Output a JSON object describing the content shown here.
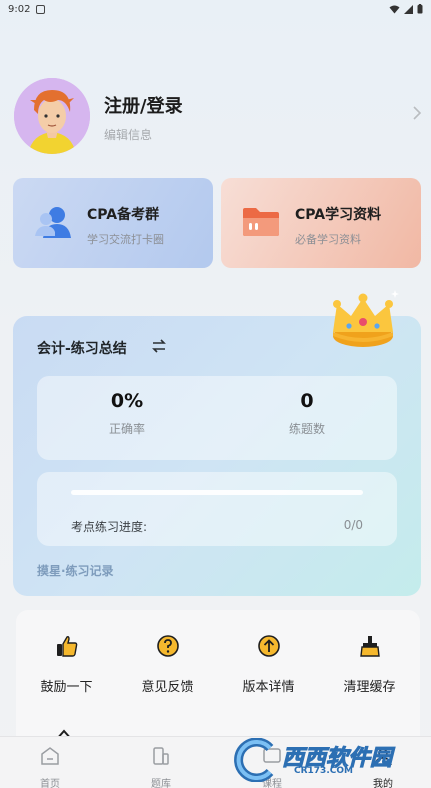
{
  "status": {
    "time": "9:02"
  },
  "profile": {
    "title": "注册/登录",
    "subtitle": "编辑信息"
  },
  "cards": [
    {
      "title": "CPA备考群",
      "subtitle": "学习交流打卡圈",
      "icon": "group-icon",
      "color": "#4d86e8"
    },
    {
      "title": "CPA学习资料",
      "subtitle": "必备学习资料",
      "icon": "folder-icon",
      "color": "#ec6a45"
    }
  ],
  "summary": {
    "title": "会计-练习总结",
    "stats": [
      {
        "value": "0%",
        "label": "正确率"
      },
      {
        "value": "0",
        "label": "练题数"
      }
    ],
    "progress": {
      "label": "考点练习进度:",
      "count": "0/0",
      "fraction": 0
    },
    "record_link": "摸星·练习记录"
  },
  "tools": [
    {
      "label": "鼓励一下",
      "icon": "thumbs-up-icon"
    },
    {
      "label": "意见反馈",
      "icon": "question-icon"
    },
    {
      "label": "版本详情",
      "icon": "arrow-up-icon"
    },
    {
      "label": "清理缓存",
      "icon": "broom-icon"
    }
  ],
  "tabs": [
    {
      "label": "首页",
      "icon": "home-icon"
    },
    {
      "label": "题库",
      "icon": "question-bank-icon"
    },
    {
      "label": "课程",
      "icon": "course-icon"
    },
    {
      "label": "我的",
      "icon": "mine-icon"
    }
  ],
  "watermark": {
    "brand": "西西软件园",
    "url": "CR173.COM"
  },
  "colors": {
    "accent_blue": "#4d86e8",
    "accent_orange": "#ec6a45",
    "icon_yellow": "#f5b82e"
  }
}
